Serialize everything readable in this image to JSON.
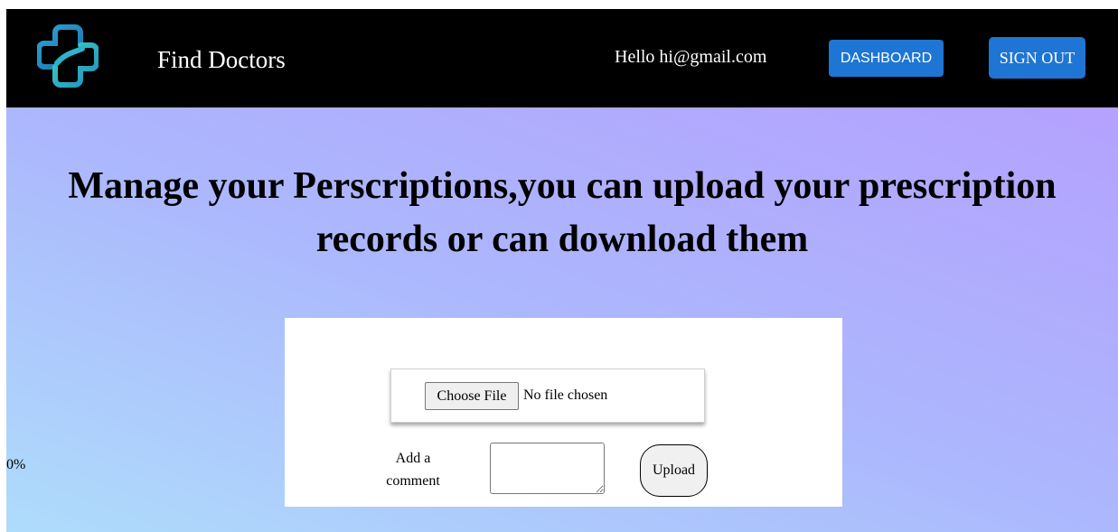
{
  "navbar": {
    "logo_icon": "medical-cross-icon",
    "brand": "Find Doctors",
    "greeting": "Hello hi@gmail.com",
    "dashboard_label": "DASHBOARD",
    "signout_label": "SIGN OUT",
    "background": "#000000",
    "button_color": "#1e75d3"
  },
  "main": {
    "heading_line1": "Manage your Perscriptions,you can upload your prescription",
    "heading_line2": "records or can download them",
    "progress_text": "0%",
    "upload_form": {
      "choose_file_label": "Choose File",
      "file_status": "No file chosen",
      "comment_label_line1": "Add a",
      "comment_label_line2": "comment",
      "comment_value": "",
      "upload_label": "Upload"
    }
  }
}
